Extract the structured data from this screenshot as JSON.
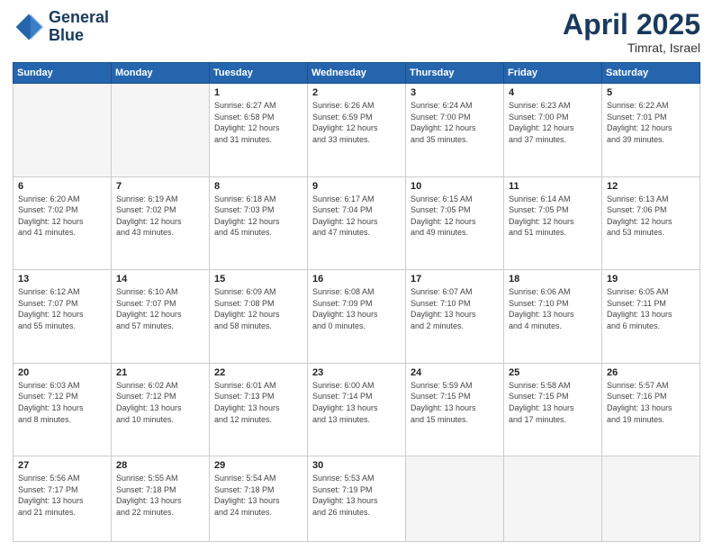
{
  "logo": {
    "line1": "General",
    "line2": "Blue"
  },
  "title": "April 2025",
  "subtitle": "Timrat, Israel",
  "days_of_week": [
    "Sunday",
    "Monday",
    "Tuesday",
    "Wednesday",
    "Thursday",
    "Friday",
    "Saturday"
  ],
  "weeks": [
    [
      {
        "day": "",
        "info": ""
      },
      {
        "day": "",
        "info": ""
      },
      {
        "day": "1",
        "info": "Sunrise: 6:27 AM\nSunset: 6:58 PM\nDaylight: 12 hours\nand 31 minutes."
      },
      {
        "day": "2",
        "info": "Sunrise: 6:26 AM\nSunset: 6:59 PM\nDaylight: 12 hours\nand 33 minutes."
      },
      {
        "day": "3",
        "info": "Sunrise: 6:24 AM\nSunset: 7:00 PM\nDaylight: 12 hours\nand 35 minutes."
      },
      {
        "day": "4",
        "info": "Sunrise: 6:23 AM\nSunset: 7:00 PM\nDaylight: 12 hours\nand 37 minutes."
      },
      {
        "day": "5",
        "info": "Sunrise: 6:22 AM\nSunset: 7:01 PM\nDaylight: 12 hours\nand 39 minutes."
      }
    ],
    [
      {
        "day": "6",
        "info": "Sunrise: 6:20 AM\nSunset: 7:02 PM\nDaylight: 12 hours\nand 41 minutes."
      },
      {
        "day": "7",
        "info": "Sunrise: 6:19 AM\nSunset: 7:02 PM\nDaylight: 12 hours\nand 43 minutes."
      },
      {
        "day": "8",
        "info": "Sunrise: 6:18 AM\nSunset: 7:03 PM\nDaylight: 12 hours\nand 45 minutes."
      },
      {
        "day": "9",
        "info": "Sunrise: 6:17 AM\nSunset: 7:04 PM\nDaylight: 12 hours\nand 47 minutes."
      },
      {
        "day": "10",
        "info": "Sunrise: 6:15 AM\nSunset: 7:05 PM\nDaylight: 12 hours\nand 49 minutes."
      },
      {
        "day": "11",
        "info": "Sunrise: 6:14 AM\nSunset: 7:05 PM\nDaylight: 12 hours\nand 51 minutes."
      },
      {
        "day": "12",
        "info": "Sunrise: 6:13 AM\nSunset: 7:06 PM\nDaylight: 12 hours\nand 53 minutes."
      }
    ],
    [
      {
        "day": "13",
        "info": "Sunrise: 6:12 AM\nSunset: 7:07 PM\nDaylight: 12 hours\nand 55 minutes."
      },
      {
        "day": "14",
        "info": "Sunrise: 6:10 AM\nSunset: 7:07 PM\nDaylight: 12 hours\nand 57 minutes."
      },
      {
        "day": "15",
        "info": "Sunrise: 6:09 AM\nSunset: 7:08 PM\nDaylight: 12 hours\nand 58 minutes."
      },
      {
        "day": "16",
        "info": "Sunrise: 6:08 AM\nSunset: 7:09 PM\nDaylight: 13 hours\nand 0 minutes."
      },
      {
        "day": "17",
        "info": "Sunrise: 6:07 AM\nSunset: 7:10 PM\nDaylight: 13 hours\nand 2 minutes."
      },
      {
        "day": "18",
        "info": "Sunrise: 6:06 AM\nSunset: 7:10 PM\nDaylight: 13 hours\nand 4 minutes."
      },
      {
        "day": "19",
        "info": "Sunrise: 6:05 AM\nSunset: 7:11 PM\nDaylight: 13 hours\nand 6 minutes."
      }
    ],
    [
      {
        "day": "20",
        "info": "Sunrise: 6:03 AM\nSunset: 7:12 PM\nDaylight: 13 hours\nand 8 minutes."
      },
      {
        "day": "21",
        "info": "Sunrise: 6:02 AM\nSunset: 7:12 PM\nDaylight: 13 hours\nand 10 minutes."
      },
      {
        "day": "22",
        "info": "Sunrise: 6:01 AM\nSunset: 7:13 PM\nDaylight: 13 hours\nand 12 minutes."
      },
      {
        "day": "23",
        "info": "Sunrise: 6:00 AM\nSunset: 7:14 PM\nDaylight: 13 hours\nand 13 minutes."
      },
      {
        "day": "24",
        "info": "Sunrise: 5:59 AM\nSunset: 7:15 PM\nDaylight: 13 hours\nand 15 minutes."
      },
      {
        "day": "25",
        "info": "Sunrise: 5:58 AM\nSunset: 7:15 PM\nDaylight: 13 hours\nand 17 minutes."
      },
      {
        "day": "26",
        "info": "Sunrise: 5:57 AM\nSunset: 7:16 PM\nDaylight: 13 hours\nand 19 minutes."
      }
    ],
    [
      {
        "day": "27",
        "info": "Sunrise: 5:56 AM\nSunset: 7:17 PM\nDaylight: 13 hours\nand 21 minutes."
      },
      {
        "day": "28",
        "info": "Sunrise: 5:55 AM\nSunset: 7:18 PM\nDaylight: 13 hours\nand 22 minutes."
      },
      {
        "day": "29",
        "info": "Sunrise: 5:54 AM\nSunset: 7:18 PM\nDaylight: 13 hours\nand 24 minutes."
      },
      {
        "day": "30",
        "info": "Sunrise: 5:53 AM\nSunset: 7:19 PM\nDaylight: 13 hours\nand 26 minutes."
      },
      {
        "day": "",
        "info": ""
      },
      {
        "day": "",
        "info": ""
      },
      {
        "day": "",
        "info": ""
      }
    ]
  ]
}
